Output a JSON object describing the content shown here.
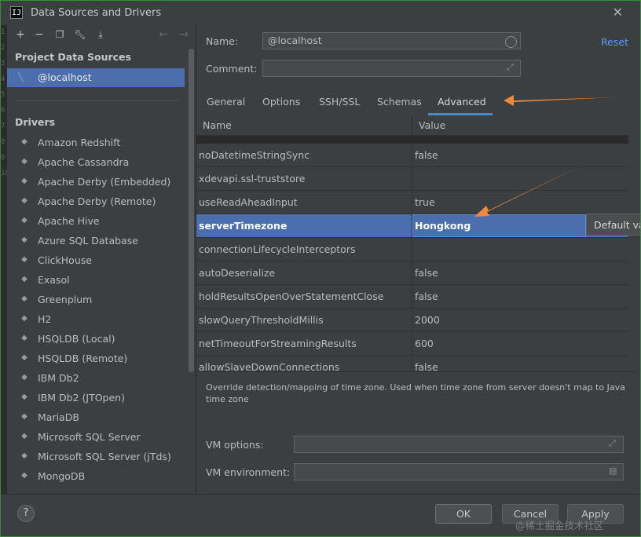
{
  "window": {
    "title": "Data Sources and Drivers",
    "app_icon_label": "IJ"
  },
  "gutter": [
    "1",
    "2",
    "3",
    "4",
    "5",
    "6",
    "7",
    "8",
    "9",
    "10"
  ],
  "left_panel": {
    "project_title": "Project Data Sources",
    "data_source": "@localhost",
    "drivers_title": "Drivers",
    "drivers": [
      {
        "label": "Amazon Redshift",
        "icon": "redshift-icon"
      },
      {
        "label": "Apache Cassandra",
        "icon": "cassandra-icon"
      },
      {
        "label": "Apache Derby (Embedded)",
        "icon": "derby-icon"
      },
      {
        "label": "Apache Derby (Remote)",
        "icon": "derby-icon"
      },
      {
        "label": "Apache Hive",
        "icon": "hive-icon"
      },
      {
        "label": "Azure SQL Database",
        "icon": "azure-icon"
      },
      {
        "label": "ClickHouse",
        "icon": "clickhouse-icon"
      },
      {
        "label": "Exasol",
        "icon": "exasol-icon"
      },
      {
        "label": "Greenplum",
        "icon": "greenplum-icon"
      },
      {
        "label": "H2",
        "icon": "h2-icon"
      },
      {
        "label": "HSQLDB (Local)",
        "icon": "hsqldb-icon"
      },
      {
        "label": "HSQLDB (Remote)",
        "icon": "hsqldb-icon"
      },
      {
        "label": "IBM Db2",
        "icon": "db2-icon"
      },
      {
        "label": "IBM Db2 (JTOpen)",
        "icon": "db2-icon"
      },
      {
        "label": "MariaDB",
        "icon": "mariadb-icon"
      },
      {
        "label": "Microsoft SQL Server",
        "icon": "mssql-icon"
      },
      {
        "label": "Microsoft SQL Server (jTds)",
        "icon": "mssql-icon"
      },
      {
        "label": "MongoDB",
        "icon": "mongodb-icon"
      }
    ]
  },
  "form": {
    "name_label": "Name:",
    "name_value": "@localhost",
    "comment_label": "Comment:",
    "comment_value": "",
    "reset_label": "Reset"
  },
  "tabs": [
    "General",
    "Options",
    "SSH/SSL",
    "Schemas",
    "Advanced"
  ],
  "active_tab": "Advanced",
  "properties": {
    "col_name": "Name",
    "col_value": "Value",
    "rows": [
      {
        "name": "noDatetimeStringSync",
        "value": "false"
      },
      {
        "name": "xdevapi.ssl-truststore",
        "value": ""
      },
      {
        "name": "useReadAheadInput",
        "value": "true"
      },
      {
        "name": "serverTimezone",
        "value": "Hongkong",
        "selected": true
      },
      {
        "name": "connectionLifecycleInterceptors",
        "value": ""
      },
      {
        "name": "autoDeserialize",
        "value": "false"
      },
      {
        "name": "holdResultsOpenOverStatementClose",
        "value": "false"
      },
      {
        "name": "slowQueryThresholdMillis",
        "value": "2000"
      },
      {
        "name": "netTimeoutForStreamingResults",
        "value": "600"
      },
      {
        "name": "allowSlaveDownConnections",
        "value": "false"
      }
    ]
  },
  "tooltip": "Default val",
  "description": "Override detection/mapping of time zone. Used when time zone from server doesn't map to Java time zone",
  "vm_options_label": "VM options:",
  "vm_options_value": "",
  "vm_env_label": "VM environment:",
  "vm_env_value": "",
  "buttons": {
    "ok": "OK",
    "cancel": "Cancel",
    "apply": "Apply",
    "help": "?"
  },
  "watermark": "@稀土掘金技术社区",
  "colors": {
    "accent": "#4b6eaf",
    "annotation_arrow": "#f08a3a",
    "link": "#589df6"
  }
}
